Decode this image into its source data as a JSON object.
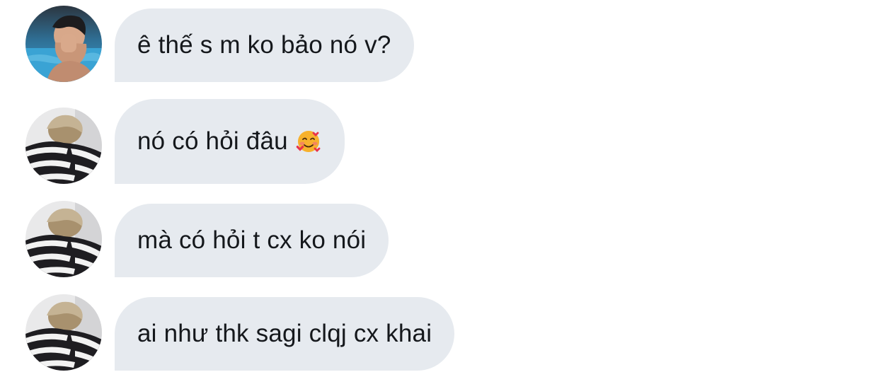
{
  "messages": [
    {
      "text": "ê thế s m ko bảo nó v?",
      "avatar_icon": "avatar-pool-photo",
      "emoji": ""
    },
    {
      "text": "nó có hỏi đâu",
      "avatar_icon": "avatar-striped-sweater-photo",
      "emoji": "smiling-face-with-hearts-icon"
    },
    {
      "text": "mà có hỏi t cx ko nói",
      "avatar_icon": "avatar-striped-sweater-photo",
      "emoji": ""
    },
    {
      "text": "ai như thk sagi clqj cx khai",
      "avatar_icon": "avatar-striped-sweater-photo",
      "emoji": ""
    }
  ],
  "colors": {
    "bubble_bg": "#e6eaef",
    "text": "#15181c",
    "background": "#ffffff"
  }
}
